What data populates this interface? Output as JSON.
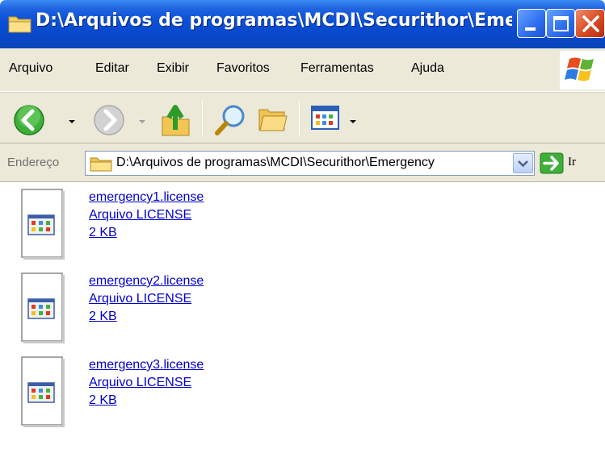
{
  "window": {
    "title": "D:\\Arquivos de programas\\MCDI\\Securithor\\Emerge..."
  },
  "menu": {
    "items": [
      "Arquivo",
      "Editar",
      "Exibir",
      "Favoritos",
      "Ferramentas",
      "Ajuda"
    ]
  },
  "address": {
    "label": "Endereço",
    "value": "D:\\Arquivos de programas\\MCDI\\Securithor\\Emergency",
    "go_label": "Ir"
  },
  "files": [
    {
      "name": "emergency1.license",
      "type": "Arquivo LICENSE",
      "size": "2 KB"
    },
    {
      "name": "emergency2.license",
      "type": "Arquivo LICENSE",
      "size": "2 KB"
    },
    {
      "name": "emergency3.license",
      "type": "Arquivo LICENSE",
      "size": "2 KB"
    }
  ],
  "icons": {
    "title": "folder-icon",
    "back": "back-arrow-icon",
    "forward": "forward-arrow-icon",
    "up": "up-folder-icon",
    "search": "search-icon",
    "folders": "folders-icon",
    "views": "views-icon",
    "go": "go-arrow-icon",
    "file": "license-file-icon"
  },
  "colors": {
    "titlebar": "#0a4fd6",
    "chrome": "#ece9d8",
    "link": "#0000cc"
  }
}
